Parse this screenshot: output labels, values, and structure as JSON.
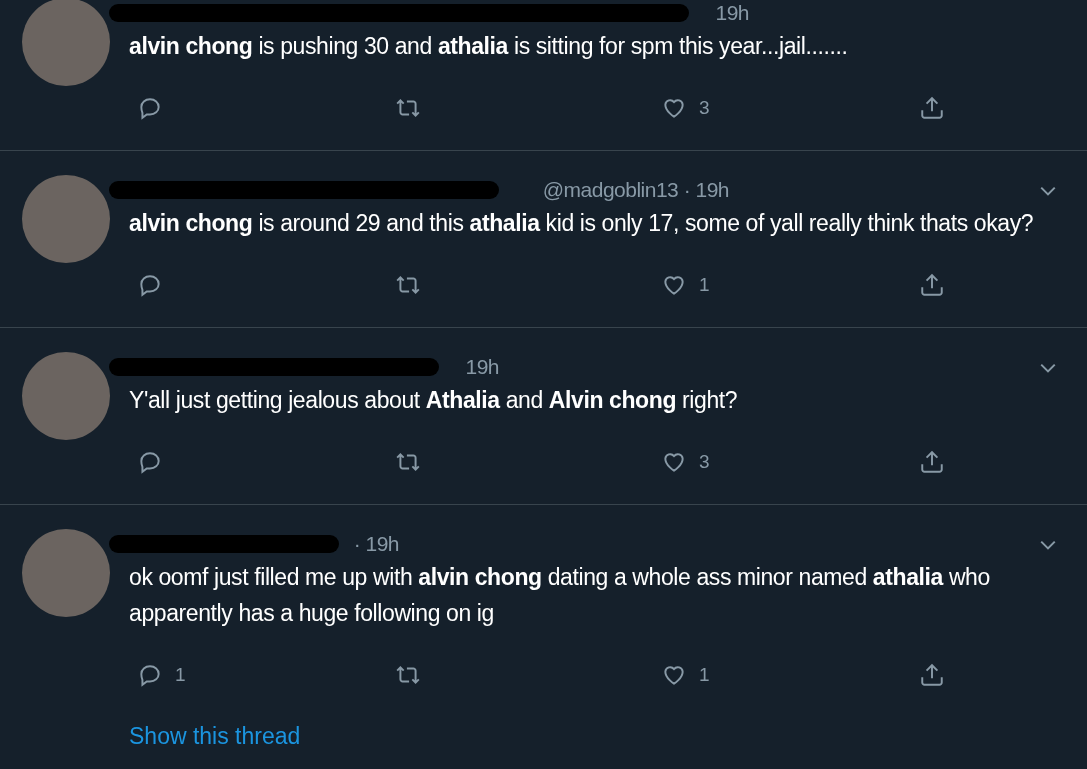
{
  "tweets": [
    {
      "meta": "19h",
      "text": "**alvin chong** is pushing 30 and **athalia** is sitting for spm this year...jail.......",
      "like_count": "3",
      "redacted": true
    },
    {
      "meta": "@madgoblin13 · 19h",
      "text": "**alvin chong** is around 29 and this **athalia** kid is only 17, some of yall really think thats okay?",
      "like_count": "1",
      "redacted": true
    },
    {
      "meta": "19h",
      "text": "Y'all just getting jealous about **Athalia** and **Alvin chong** right?",
      "like_count": "3",
      "redacted": true
    },
    {
      "meta": "· 19h",
      "text": "ok oomf just filled me up with **alvin chong** dating a whole ass minor named **athalia** who apparently has a huge following on ig",
      "reply_count": "1",
      "like_count": "1",
      "redacted": true,
      "link": "Show this thread"
    }
  ]
}
